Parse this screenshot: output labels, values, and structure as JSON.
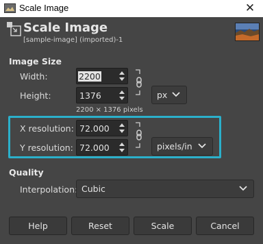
{
  "window": {
    "title": "Scale Image",
    "close_glyph": "✕"
  },
  "header": {
    "title": "Scale Image",
    "subtitle": "[sample-image] (imported)-1"
  },
  "image_size": {
    "section": "Image Size",
    "width_label": "Width:",
    "width_value": "2200",
    "height_label": "Height:",
    "height_value": "1376",
    "unit": "px",
    "pixels_hint": "2200 × 1376 pixels"
  },
  "resolution": {
    "x_label": "X resolution:",
    "x_value": "72.000",
    "y_label": "Y resolution:",
    "y_value": "72.000",
    "unit": "pixels/in"
  },
  "quality": {
    "section": "Quality",
    "interpolation_label": "Interpolation:",
    "interpolation_value": "Cubic"
  },
  "buttons": {
    "help": "Help",
    "reset": "Reset",
    "scale": "Scale",
    "cancel": "Cancel"
  },
  "colors": {
    "highlight": "#2bb0cb",
    "background": "#454545"
  }
}
